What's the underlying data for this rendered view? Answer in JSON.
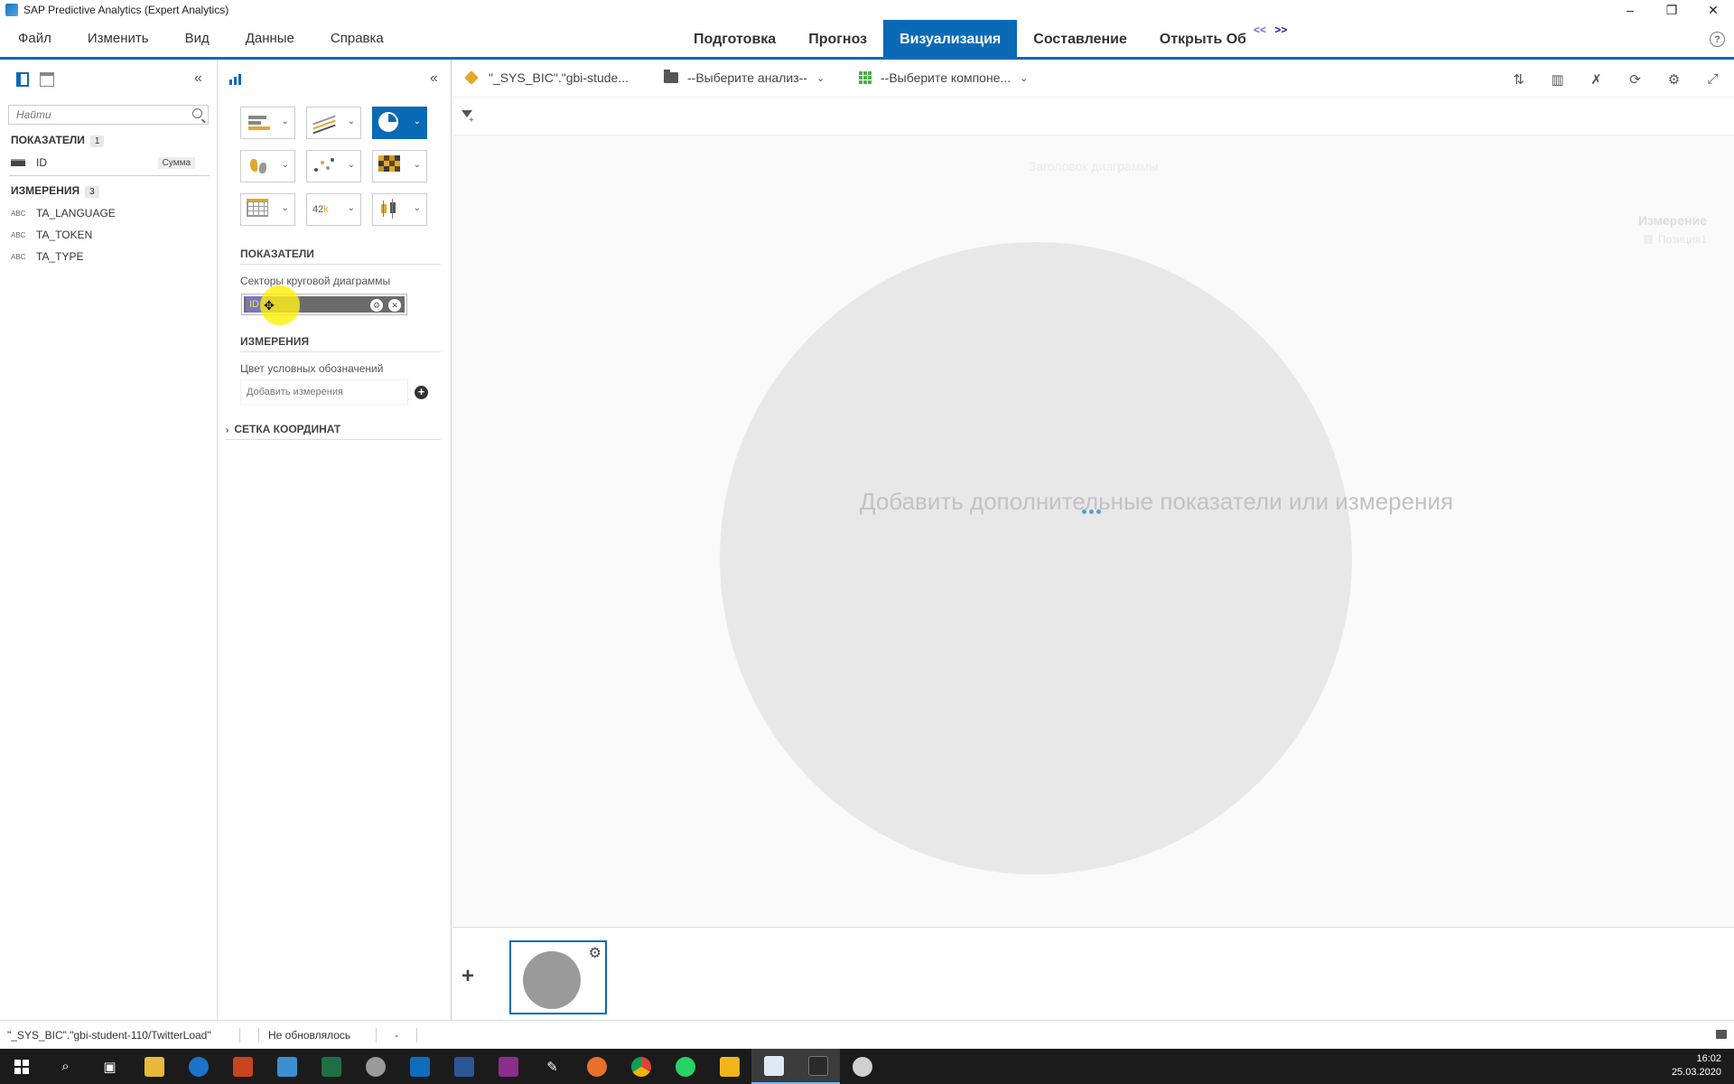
{
  "window": {
    "title": "SAP Predictive Analytics (Expert Analytics)",
    "controls": [
      "–",
      "❐",
      "✕"
    ]
  },
  "menu": [
    "Файл",
    "Изменить",
    "Вид",
    "Данные",
    "Справка"
  ],
  "main_tabs": [
    {
      "label": "Подготовка",
      "active": false
    },
    {
      "label": "Прогноз",
      "active": false
    },
    {
      "label": "Визуализация",
      "active": true
    },
    {
      "label": "Составление",
      "active": false
    },
    {
      "label": "Открыть Об",
      "active": false
    }
  ],
  "tab_scroll": {
    "left": "<<",
    "right": ">>"
  },
  "help": "?",
  "left_pane": {
    "collapse": "«",
    "search_placeholder": "Найти",
    "measures": {
      "title": "ПОКАЗАТЕЛИ",
      "count": "1",
      "items": [
        {
          "name": "ID",
          "aggregation": "Сумма"
        }
      ]
    },
    "dimensions": {
      "title": "ИЗМЕРЕНИЯ",
      "count": "3",
      "items": [
        {
          "type": "ABC",
          "name": "TA_LANGUAGE"
        },
        {
          "type": "ABC",
          "name": "TA_TOKEN"
        },
        {
          "type": "ABC",
          "name": "TA_TYPE"
        }
      ]
    }
  },
  "builder": {
    "collapse": "«",
    "chart_types": [
      "bar",
      "line",
      "pie",
      "geo",
      "scatter",
      "heatmap",
      "table",
      "numeric-point",
      "box-plot"
    ],
    "active_chart_type": "pie",
    "kpi_icon": {
      "num": "42",
      "suffix": "k"
    },
    "measures_title": "ПОКАЗАТЕЛИ",
    "pie_sectors_label": "Секторы круговой диаграммы",
    "measure_chip": "ID",
    "dimensions_title": "ИЗМЕРЕНИЯ",
    "legend_color_label": "Цвет условных обозначений",
    "add_dimension_placeholder": "Добавить измерения",
    "grid_section": "СЕТКА КООРДИНАТ"
  },
  "toolbar": {
    "dataset": "\"_SYS_BIC\".\"gbi-stude...",
    "analysis": "--Выберите анализ--",
    "component": "--Выберите компоне..."
  },
  "canvas": {
    "chart_title": "Заголовок диаграммы",
    "legend_title": "Измерение",
    "legend_item": "Позиция1",
    "placeholder": "Добавить дополнительные показатели или измерения"
  },
  "page_strip": {
    "add": "+"
  },
  "status": {
    "source": "\"_SYS_BIC\".\"gbi-student-110/TwitterLoad\"",
    "refresh": "Не обновлялось",
    "dash": "-"
  },
  "taskbar": {
    "time": "16:02",
    "date": "25.03.2020"
  }
}
